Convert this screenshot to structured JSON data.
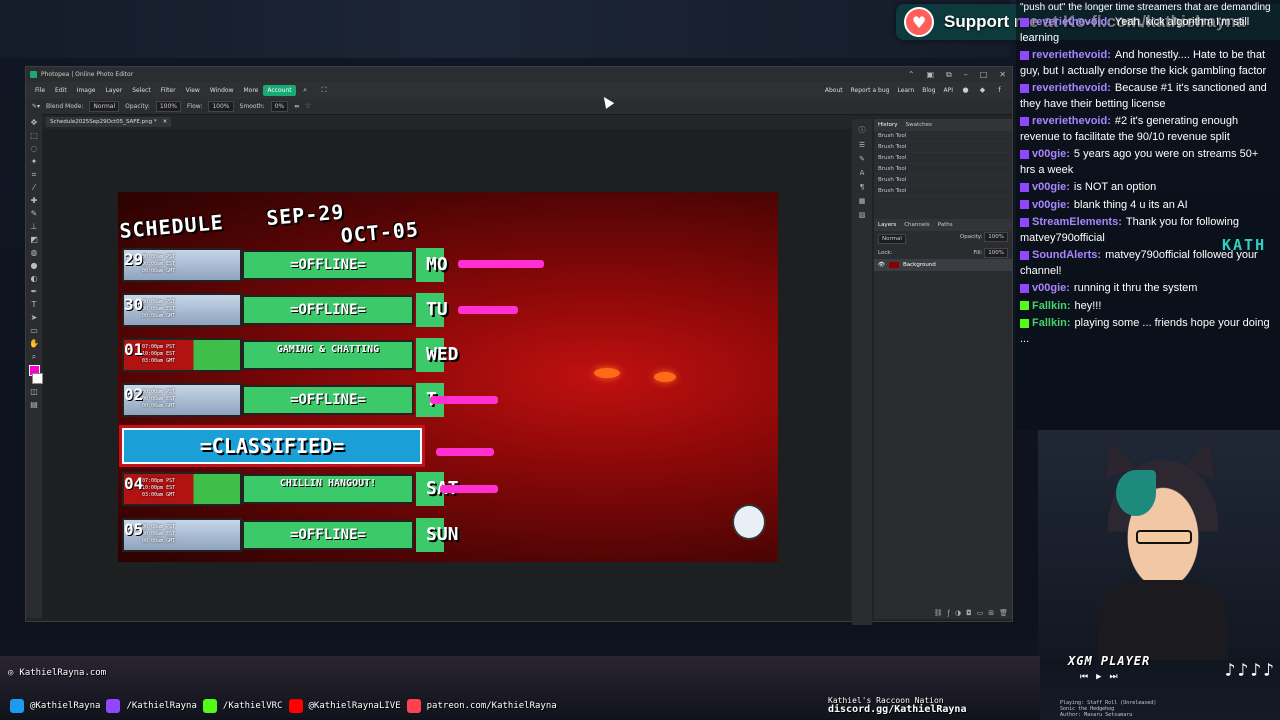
{
  "stream": {
    "support_text": "Support me at Ko-fi.com/kathielrayna",
    "chat_cut_text": "\"push out\" the longer time streamers that are demanding to much vs young blood"
  },
  "photopea": {
    "title": "Photopea | Online Photo Editor",
    "menu": [
      "File",
      "Edit",
      "Image",
      "Layer",
      "Select",
      "Filter",
      "View",
      "Window",
      "More"
    ],
    "account_label": "Account",
    "right_links": [
      "About",
      "Report a bug",
      "Learn",
      "Blog",
      "API"
    ],
    "options": {
      "blend_mode_label": "Blend Mode:",
      "blend_mode": "Normal",
      "opacity_label": "Opacity:",
      "opacity": "100%",
      "flow_label": "Flow:",
      "flow": "100%",
      "smooth_label": "Smooth:",
      "smooth": "0%"
    },
    "document_tab": "Schedule2025Sep29Oct05_SAFE.png *",
    "panel_tabs": [
      "History",
      "Swatches"
    ],
    "history": [
      "Brush Tool",
      "Brush Tool",
      "Brush Tool",
      "Brush Tool",
      "Brush Tool",
      "Brush Tool"
    ],
    "layer_tabs": [
      "Layers",
      "Channels",
      "Paths"
    ],
    "layer_blend": "Normal",
    "layer_opacity_label": "Opacity:",
    "layer_opacity": "100%",
    "lock_label": "Lock:",
    "fill_label": "Fill:",
    "fill": "100%",
    "layer_name": "Background"
  },
  "schedule": {
    "title_line1": "SCHEDULE",
    "title_date1": "SEP-29",
    "title_date2": "OCT-05",
    "rows": [
      {
        "num": "29",
        "time": "00:00am PST\n00:00am EST\n00:00am GMT",
        "status": "=OFFLINE=",
        "day": "MO"
      },
      {
        "num": "30",
        "time": "00:00am PST\n00:00am EST\n00:00am GMT",
        "status": "=OFFLINE=",
        "day": "TU"
      },
      {
        "num": "01",
        "time": "07:00pm PST\n10:00pm EST\n03:00am GMT",
        "status": "GAMING & CHATTING",
        "day": "WED"
      },
      {
        "num": "02",
        "time": "00:00am PST\n00:00am EST\n00:00am GMT",
        "status": "=OFFLINE=",
        "day": "T"
      },
      {
        "num": "04",
        "time": "07:00pm PST\n10:00pm EST\n03:00am GMT",
        "status": "CHILLIN HANGOUT!",
        "day": "SAT"
      },
      {
        "num": "05",
        "time": "00:00am PST\n00:00am EST\n00:00am GMT",
        "status": "=OFFLINE=",
        "day": "SUN"
      }
    ],
    "classified": "=CLASSIFIED="
  },
  "chat": [
    {
      "user": "reverieth​evoid:",
      "text": "Yeah, kick algorithm I'm still learning",
      "color": "#a986ff"
    },
    {
      "user": "reverieth​evoid:",
      "text": "And honestly.... Hate to be that guy, but I actually endorse the kick gambling factor",
      "color": "#a986ff"
    },
    {
      "user": "reverieth​evoid:",
      "text": "Because #1 it's sanctioned and they have their betting license",
      "color": "#a986ff"
    },
    {
      "user": "reverieth​evoid:",
      "text": "#2 it's generating enough revenue to facilitate the 90/10 revenue split",
      "color": "#a986ff"
    },
    {
      "user": "v00gie:",
      "text": "5 years ago you were on streams 50+ hrs a week",
      "color": "#a986ff"
    },
    {
      "user": "v00gie:",
      "text": "is NOT an option",
      "color": "#a986ff"
    },
    {
      "user": "v00gie:",
      "text": "blank thing 4 u its an AI",
      "color": "#a986ff"
    },
    {
      "user": "StreamElements:",
      "text": "Thank you for following matvey790official",
      "color": "#a986ff"
    },
    {
      "user": "SoundAlerts:",
      "text": "matvey790official followed your channel!",
      "color": "#a986ff"
    },
    {
      "user": "v00gie:",
      "text": "running it thru the system",
      "color": "#a986ff"
    },
    {
      "user": "Fallkin:",
      "text": "hey!!!",
      "color": "#48d26b"
    },
    {
      "user": "Fallkin:",
      "text": "playing some ... friends hope your doing ...",
      "color": "#48d26b"
    }
  ],
  "side_text": "KATH",
  "music_player": {
    "title": "XGM PLAYER",
    "notes": "♪♪♪♪",
    "track_line1": "Playing: Staff Roll (Unreleased)",
    "track_line2": "Sonic the Hedgehog",
    "track_line3": "Author: Masaru Setsumaru"
  },
  "bottom": {
    "site": "KathielRayna.com",
    "socials": [
      "@KathielRayna",
      "/KathielRayna",
      "/KathielVRC",
      "@KathielRaynaLIVE",
      "patreon.com/KathielRayna"
    ],
    "discord_name": "Kathiel's Raccoon Nation",
    "discord_url": "discord.gg/KathielRayna"
  },
  "colors": {
    "accent": "#19a974",
    "offline_green": "#3cc96a",
    "classified_blue": "#1b9fd7",
    "highlight_pink": "#ff2fd1"
  }
}
